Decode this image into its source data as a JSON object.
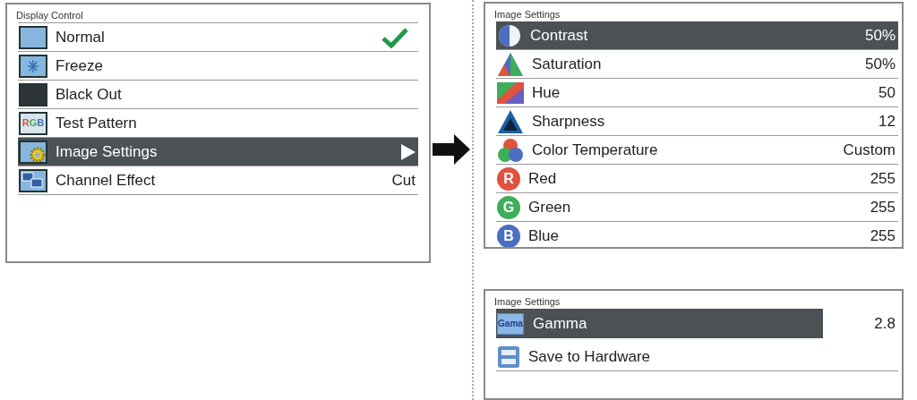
{
  "panels": [
    {
      "title": "Display Control",
      "items": [
        {
          "label": "Normal",
          "kind": "plain",
          "selected": false,
          "checked": true
        },
        {
          "label": "Freeze",
          "kind": "plain",
          "selected": false,
          "checked": false
        },
        {
          "label": "Black Out",
          "kind": "plain",
          "selected": false,
          "checked": false
        },
        {
          "label": "Test Pattern",
          "icon_text": "RGB",
          "kind": "plain",
          "selected": false,
          "checked": false
        },
        {
          "label": "Image Settings",
          "kind": "submenu",
          "selected": true,
          "checked": false
        },
        {
          "label": "Channel Effect",
          "kind": "value",
          "value": "Cut",
          "selected": false,
          "checked": false
        }
      ]
    },
    {
      "title": "Image Settings",
      "items": [
        {
          "label": "Contrast",
          "kind": "value",
          "value": "50%",
          "selected": true
        },
        {
          "label": "Saturation",
          "kind": "value",
          "value": "50%",
          "selected": false
        },
        {
          "label": "Hue",
          "kind": "value",
          "value": "50",
          "selected": false
        },
        {
          "label": "Sharpness",
          "kind": "value",
          "value": "12",
          "selected": false
        },
        {
          "label": "Color Temperature",
          "kind": "value",
          "value": "Custom",
          "selected": false
        },
        {
          "label": "Red",
          "icon_text": "R",
          "color": "#e0533f",
          "kind": "value",
          "value": "255",
          "selected": false
        },
        {
          "label": "Green",
          "icon_text": "G",
          "color": "#3fae5a",
          "kind": "value",
          "value": "255",
          "selected": false
        },
        {
          "label": "Blue",
          "icon_text": "B",
          "color": "#4a6fc0",
          "kind": "value",
          "value": "255",
          "selected": false
        }
      ]
    },
    {
      "title": "Image Settings",
      "items": [
        {
          "label": "Gamma",
          "icon_text": "Gama",
          "kind": "value-box",
          "value": "2.8",
          "selected": true
        },
        {
          "label": "Save to Hardware",
          "kind": "plain",
          "selected": false
        }
      ]
    }
  ]
}
